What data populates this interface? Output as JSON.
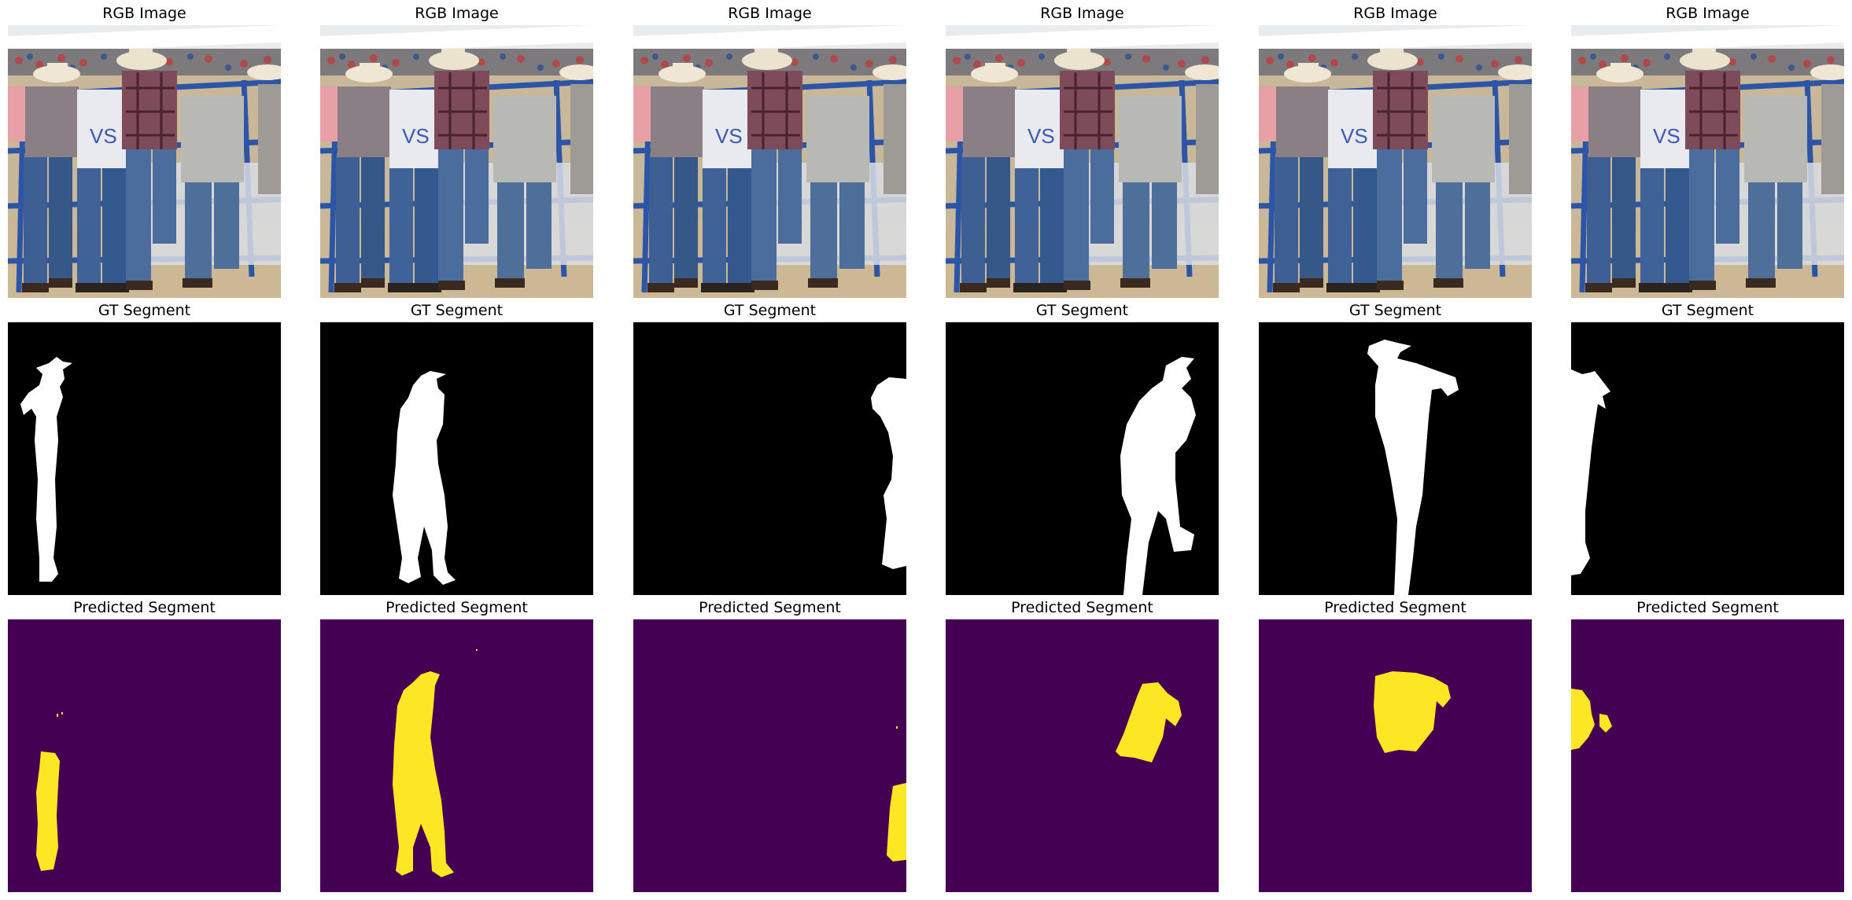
{
  "figure": {
    "row_titles": {
      "rgb": "RGB Image",
      "gt": "GT Segment",
      "pred": "Predicted Segment"
    },
    "colors": {
      "background": "#ffffff",
      "gt_background": "#000000",
      "gt_foreground": "#ffffff",
      "pred_background": "#440154",
      "pred_foreground": "#fde725"
    },
    "columns": [
      {
        "rgb_title": "RGB Image",
        "gt_title": "GT Segment",
        "pred_title": "Predicted Segment"
      },
      {
        "rgb_title": "RGB Image",
        "gt_title": "GT Segment",
        "pred_title": "Predicted Segment"
      },
      {
        "rgb_title": "RGB Image",
        "gt_title": "GT Segment",
        "pred_title": "Predicted Segment"
      },
      {
        "rgb_title": "RGB Image",
        "gt_title": "GT Segment",
        "pred_title": "Predicted Segment"
      },
      {
        "rgb_title": "RGB Image",
        "gt_title": "GT Segment",
        "pred_title": "Predicted Segment"
      },
      {
        "rgb_title": "RGB Image",
        "gt_title": "GT Segment",
        "pred_title": "Predicted Segment"
      }
    ]
  }
}
